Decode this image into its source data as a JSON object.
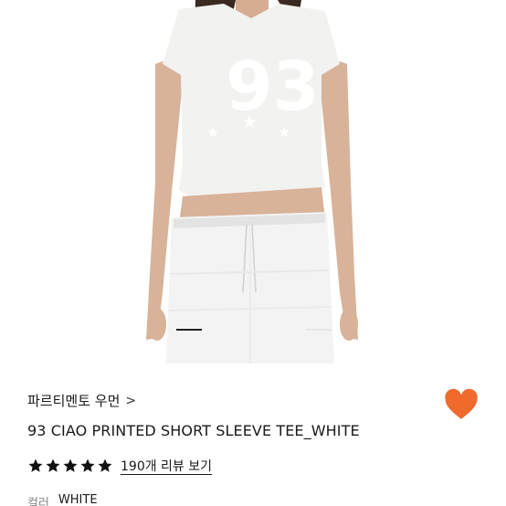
{
  "product": {
    "brand": "파르티멘토 우먼",
    "brand_chevron": ">",
    "title": "93 CIAO PRINTED SHORT SLEEVE TEE_WHITE",
    "print_text": "93",
    "rating_stars": 5,
    "review_link": "190개 리뷰 보기",
    "color_label": "컬러",
    "color_value": "WHITE"
  },
  "colors": {
    "heart": "#ef6a2d",
    "star": "#111111"
  },
  "icons": {
    "favorite": "heart-icon",
    "rating": "star-icon",
    "brand_link": "chevron-right-icon"
  }
}
